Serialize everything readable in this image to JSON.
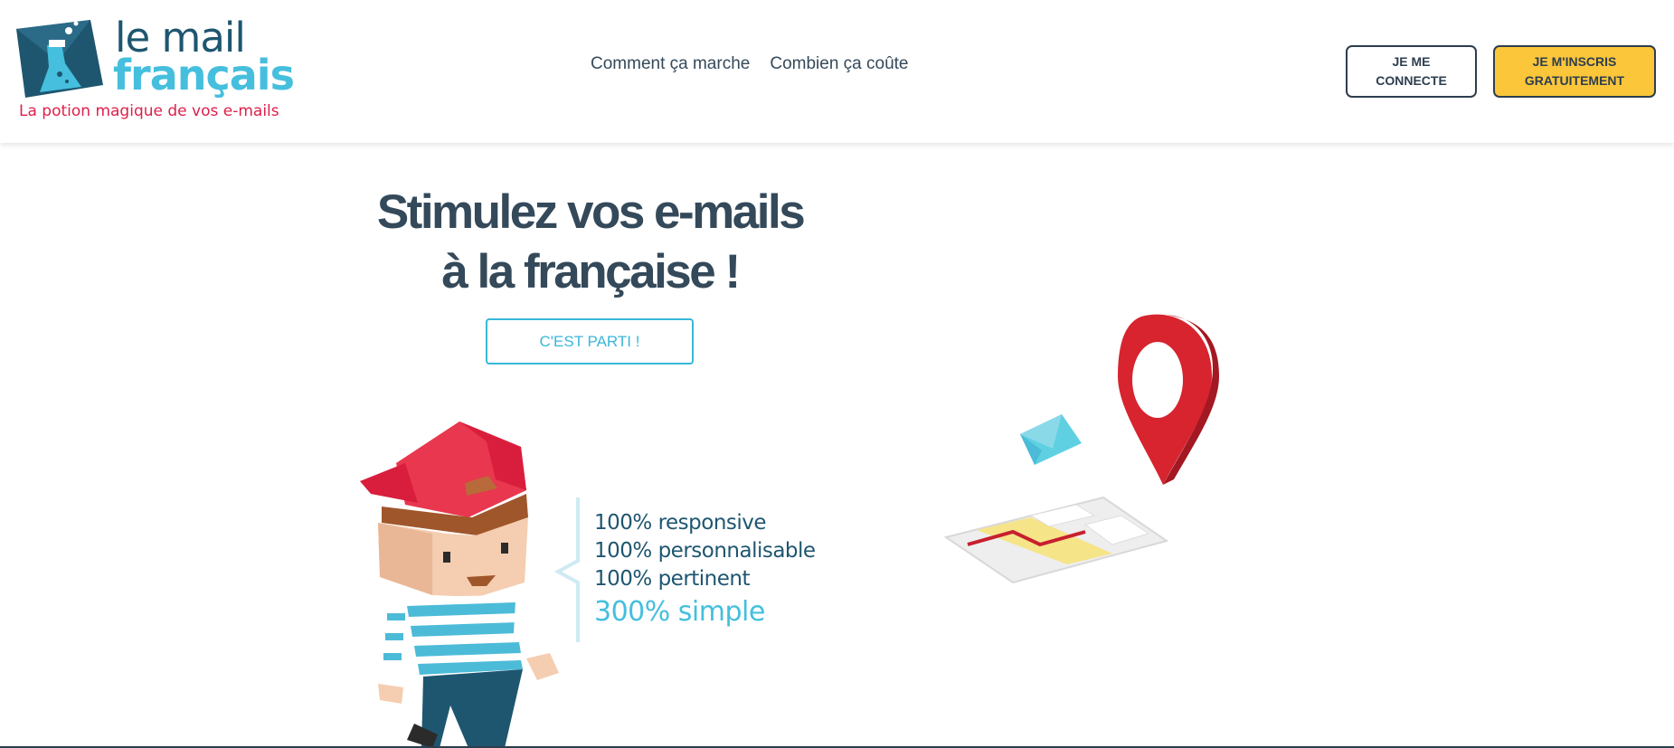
{
  "logo": {
    "word1": "le mail",
    "word2": "français",
    "tagline": "La potion magique de vos e-mails"
  },
  "nav": {
    "items": [
      "Comment ça marche",
      "Combien ça coûte"
    ]
  },
  "header_buttons": {
    "login": [
      "JE ME",
      "CONNECTE"
    ],
    "signup": [
      "JE M'INSCRIS",
      "GRATUITEMENT"
    ]
  },
  "hero": {
    "title_line1": "Stimulez vos e-mails",
    "title_line2": "à la française !",
    "cta": "C'EST PARTI !"
  },
  "features": [
    "100% responsive",
    "100% personnalisable",
    "100% pertinent",
    "300% simple"
  ],
  "colors": {
    "brand_dark": "#34495a",
    "brand_blue": "#45bfdd",
    "brand_red": "#dd1f4a",
    "cta_yellow": "#fbc63a"
  }
}
